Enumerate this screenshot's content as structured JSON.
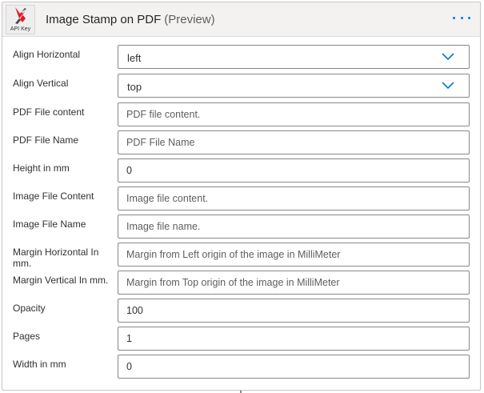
{
  "header": {
    "title": "Image Stamp on PDF",
    "preview": "(Preview)",
    "logo_text": "API Key"
  },
  "fields": [
    {
      "label": "Align Horizontal",
      "type": "dropdown",
      "value": "left",
      "placeholder": ""
    },
    {
      "label": "Align Vertical",
      "type": "dropdown",
      "value": "top",
      "placeholder": ""
    },
    {
      "label": "PDF File content",
      "type": "input",
      "value": "",
      "placeholder": "PDF file content."
    },
    {
      "label": "PDF File Name",
      "type": "input",
      "value": "",
      "placeholder": "PDF File Name"
    },
    {
      "label": "Height in mm",
      "type": "input",
      "value": "0",
      "placeholder": ""
    },
    {
      "label": "Image File Content",
      "type": "input",
      "value": "",
      "placeholder": "Image file content."
    },
    {
      "label": "Image File Name",
      "type": "input",
      "value": "",
      "placeholder": "Image file name."
    },
    {
      "label": "Margin Horizontal In mm.",
      "type": "input",
      "value": "",
      "placeholder": "Margin from Left origin of the image in MilliMeter"
    },
    {
      "label": "Margin Vertical In mm.",
      "type": "input",
      "value": "",
      "placeholder": "Margin from Top origin of the image in MilliMeter"
    },
    {
      "label": "Opacity",
      "type": "input",
      "value": "100",
      "placeholder": ""
    },
    {
      "label": "Pages",
      "type": "input",
      "value": "1",
      "placeholder": ""
    },
    {
      "label": "Width in mm",
      "type": "input",
      "value": "0",
      "placeholder": ""
    }
  ],
  "icons": {
    "logo": "api-key-logo-icon",
    "more": "more-options-icon",
    "chevron": "chevron-down-icon"
  },
  "colors": {
    "accent": "#0078d4",
    "logo_red": "#e31b23",
    "header_bg": "#f3f2f1",
    "border": "#8a8886"
  }
}
